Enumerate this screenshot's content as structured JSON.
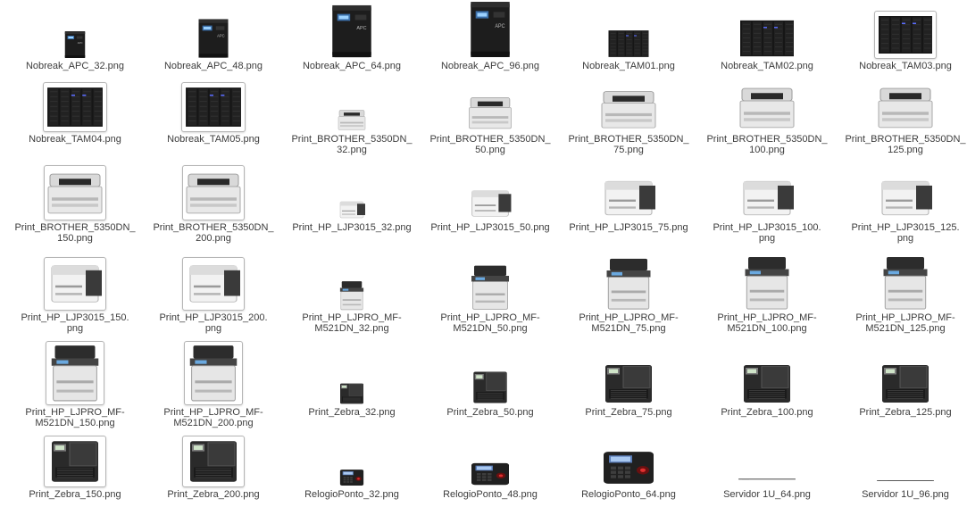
{
  "files": [
    {
      "name": "Nobreak_APC_32.png",
      "icon": "ups-apc-icon",
      "size": 32
    },
    {
      "name": "Nobreak_APC_48.png",
      "icon": "ups-apc-icon",
      "size": 48
    },
    {
      "name": "Nobreak_APC_64.png",
      "icon": "ups-apc-icon",
      "size": 64
    },
    {
      "name": "Nobreak_APC_96.png",
      "icon": "ups-apc-icon",
      "size": 96
    },
    {
      "name": "Nobreak_TAM01.png",
      "icon": "ups-cabinet-icon",
      "size": 48
    },
    {
      "name": "Nobreak_TAM02.png",
      "icon": "ups-cabinet-icon",
      "size": 64
    },
    {
      "name": "Nobreak_TAM03.png",
      "icon": "ups-cabinet-icon",
      "size": 64
    },
    {
      "name": "Nobreak_TAM04.png",
      "icon": "ups-cabinet-icon",
      "size": 64
    },
    {
      "name": "Nobreak_TAM05.png",
      "icon": "ups-cabinet-icon",
      "size": 64
    },
    {
      "name": "Print_BROTHER_5350DN_\n32.png",
      "icon": "laser-printer-brother-icon",
      "size": 32
    },
    {
      "name": "Print_BROTHER_5350DN_\n50.png",
      "icon": "laser-printer-brother-icon",
      "size": 50
    },
    {
      "name": "Print_BROTHER_5350DN_\n75.png",
      "icon": "laser-printer-brother-icon",
      "size": 64
    },
    {
      "name": "Print_BROTHER_5350DN_\n100.png",
      "icon": "laser-printer-brother-icon",
      "size": 64
    },
    {
      "name": "Print_BROTHER_5350DN_\n125.png",
      "icon": "laser-printer-brother-icon",
      "size": 64
    },
    {
      "name": "Print_BROTHER_5350DN_\n150.png",
      "icon": "laser-printer-brother-icon",
      "size": 64
    },
    {
      "name": "Print_BROTHER_5350DN_\n200.png",
      "icon": "laser-printer-brother-icon",
      "size": 64
    },
    {
      "name": "Print_HP_LJP3015_32.png",
      "icon": "laser-printer-hp-icon",
      "size": 32
    },
    {
      "name": "Print_HP_LJP3015_50.png",
      "icon": "laser-printer-hp-icon",
      "size": 50
    },
    {
      "name": "Print_HP_LJP3015_75.png",
      "icon": "laser-printer-hp-icon",
      "size": 64
    },
    {
      "name": "Print_HP_LJP3015_100.\npng",
      "icon": "laser-printer-hp-icon",
      "size": 64
    },
    {
      "name": "Print_HP_LJP3015_125.\npng",
      "icon": "laser-printer-hp-icon",
      "size": 64
    },
    {
      "name": "Print_HP_LJP3015_150.\npng",
      "icon": "laser-printer-hp-icon",
      "size": 64
    },
    {
      "name": "Print_HP_LJP3015_200.\npng",
      "icon": "laser-printer-hp-icon",
      "size": 64
    },
    {
      "name": "Print_HP_LJPRO_MF-\nM521DN_32.png",
      "icon": "mfp-printer-icon",
      "size": 32
    },
    {
      "name": "Print_HP_LJPRO_MF-\nM521DN_50.png",
      "icon": "mfp-printer-icon",
      "size": 50
    },
    {
      "name": "Print_HP_LJPRO_MF-\nM521DN_75.png",
      "icon": "mfp-printer-icon",
      "size": 64
    },
    {
      "name": "Print_HP_LJPRO_MF-\nM521DN_100.png",
      "icon": "mfp-printer-icon",
      "size": 64
    },
    {
      "name": "Print_HP_LJPRO_MF-\nM521DN_125.png",
      "icon": "mfp-printer-icon",
      "size": 64
    },
    {
      "name": "Print_HP_LJPRO_MF-\nM521DN_150.png",
      "icon": "mfp-printer-icon",
      "size": 64
    },
    {
      "name": "Print_HP_LJPRO_MF-\nM521DN_200.png",
      "icon": "mfp-printer-icon",
      "size": 64
    },
    {
      "name": "Print_Zebra_32.png",
      "icon": "label-printer-zebra-icon",
      "size": 32
    },
    {
      "name": "Print_Zebra_50.png",
      "icon": "label-printer-zebra-icon",
      "size": 50
    },
    {
      "name": "Print_Zebra_75.png",
      "icon": "label-printer-zebra-icon",
      "size": 64
    },
    {
      "name": "Print_Zebra_100.png",
      "icon": "label-printer-zebra-icon",
      "size": 64
    },
    {
      "name": "Print_Zebra_125.png",
      "icon": "label-printer-zebra-icon",
      "size": 64
    },
    {
      "name": "Print_Zebra_150.png",
      "icon": "label-printer-zebra-icon",
      "size": 64
    },
    {
      "name": "Print_Zebra_200.png",
      "icon": "label-printer-zebra-icon",
      "size": 64
    },
    {
      "name": "RelogioPonto_32.png",
      "icon": "time-clock-icon",
      "size": 32
    },
    {
      "name": "RelogioPonto_48.png",
      "icon": "time-clock-icon",
      "size": 48
    },
    {
      "name": "RelogioPonto_64.png",
      "icon": "time-clock-icon",
      "size": 64
    },
    {
      "name": "Servidor 1U_64.png",
      "icon": "rack-server-icon",
      "size": 64
    },
    {
      "name": "Servidor 1U_96.png",
      "icon": "rack-server-icon",
      "size": 96
    }
  ]
}
